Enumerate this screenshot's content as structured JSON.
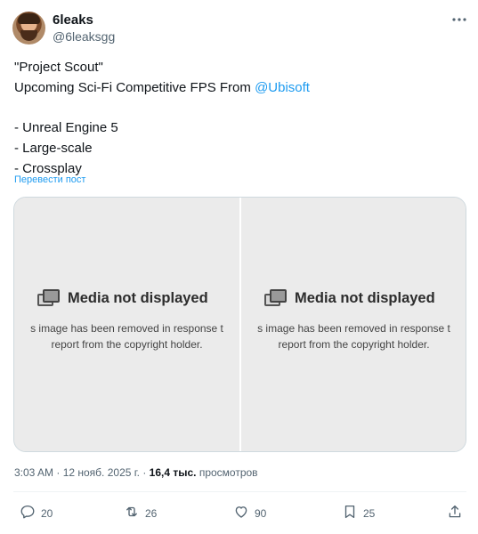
{
  "author": {
    "display_name": "6leaks",
    "handle": "@6leaksgg"
  },
  "tweet": {
    "text_before_mention": "\"Project Scout\"\nUpcoming Sci-Fi Competitive FPS From ",
    "mention": "@Ubisoft",
    "text_after_mention": "\n\n- Unreal Engine 5\n- Large-scale\n- Crossplay",
    "translate_label": "Перевести пост"
  },
  "media": [
    {
      "title": "Media not displayed",
      "line1": "s image has been removed in response t",
      "line2": "report from the copyright holder."
    },
    {
      "title": "Media not displayed",
      "line1": "s image has been removed in response t",
      "line2": "report from the copyright holder."
    }
  ],
  "meta": {
    "time": "3:03 AM",
    "dot1": " · ",
    "date": "12 нояб. 2025 г.",
    "dot2": " · ",
    "views_count": "16,4 тыс.",
    "views_label": " просмотров"
  },
  "actions": {
    "replies": "20",
    "reposts": "26",
    "likes": "90",
    "bookmarks": "25"
  },
  "colors": {
    "accent": "#1d9bf0",
    "secondary_text": "#536471",
    "border": "#cfd9de"
  },
  "icons": [
    "more-icon",
    "reply-icon",
    "repost-icon",
    "like-icon",
    "bookmark-icon",
    "share-icon",
    "media-unavailable-icon"
  ]
}
